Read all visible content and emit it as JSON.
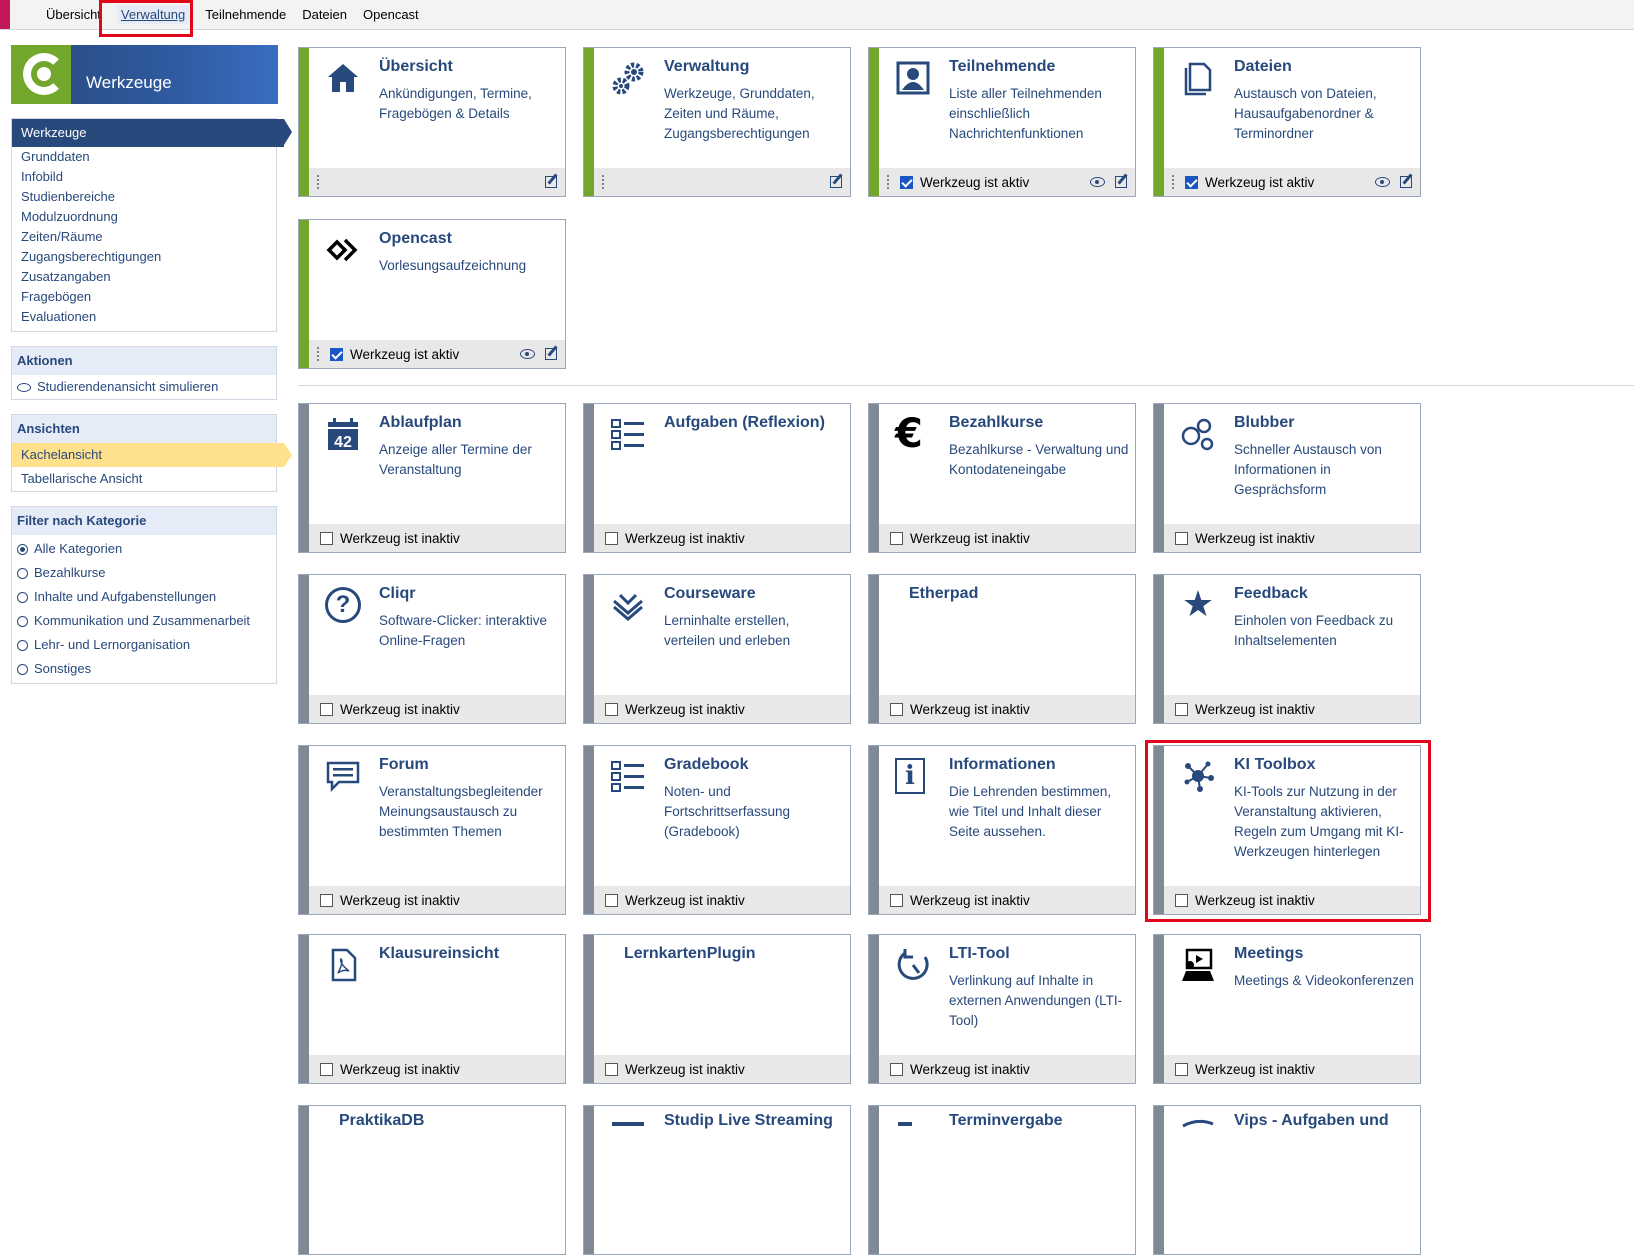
{
  "topnav": {
    "tabs": [
      "Übersicht",
      "Verwaltung",
      "Teilnehmende",
      "Dateien",
      "Opencast"
    ]
  },
  "sidebar": {
    "logo_title": "Werkzeuge",
    "nav": {
      "active": "Werkzeuge",
      "items": [
        "Grunddaten",
        "Infobild",
        "Studienbereiche",
        "Modulzuordnung",
        "Zeiten/Räume",
        "Zugangsberechtigungen",
        "Zusatzangaben",
        "Fragebögen",
        "Evaluationen"
      ]
    },
    "actions": {
      "title": "Aktionen",
      "simulate": "Studierendenansicht simulieren"
    },
    "views": {
      "title": "Ansichten",
      "tiles": "Kachelansicht",
      "table": "Tabellarische Ansicht"
    },
    "filter": {
      "title": "Filter nach Kategorie",
      "options": [
        "Alle Kategorien",
        "Bezahlkurse",
        "Inhalte und Aufgabenstellungen",
        "Kommunikation und Zusammenarbeit",
        "Lehr- und Lernorganisation",
        "Sonstiges"
      ]
    }
  },
  "status": {
    "active": "Werkzeug ist aktiv",
    "inactive": "Werkzeug ist inaktiv"
  },
  "tools": {
    "uebersicht": {
      "name": "Übersicht",
      "desc": "Ankündigungen, Termine, Fragebögen & Details",
      "icon": "home-icon"
    },
    "verwaltung": {
      "name": "Verwaltung",
      "desc": "Werkzeuge, Grunddaten, Zeiten und Räume, Zugangsberechtigungen",
      "icon": "gears-icon"
    },
    "teilnehmende": {
      "name": "Teilnehmende",
      "desc": "Liste aller Teilnehmenden einschließlich Nachrichtenfunktionen",
      "icon": "person-icon"
    },
    "dateien": {
      "name": "Dateien",
      "desc": "Austausch von Dateien, Hausaufgabenordner & Terminordner",
      "icon": "files-icon"
    },
    "opencast": {
      "name": "Opencast",
      "desc": "Vorlesungsaufzeichnung",
      "icon": "opencast-icon"
    },
    "ablaufplan": {
      "name": "Ablaufplan",
      "desc": "Anzeige aller Termine der Veranstaltung",
      "icon": "calendar-icon",
      "badge": "42"
    },
    "aufgaben": {
      "name": "Aufgaben (Reflexion)",
      "desc": "",
      "icon": "checklist-icon"
    },
    "bezahlkurse": {
      "name": "Bezahlkurse",
      "desc": "Bezahlkurse - Verwaltung und Kontodateneingabe",
      "icon": "euro-icon",
      "glyph": "€"
    },
    "blubber": {
      "name": "Blubber",
      "desc": "Schneller Austausch von Informationen in Gesprächsform",
      "icon": "bubbles-icon"
    },
    "cliqr": {
      "name": "Cliqr",
      "desc": "Software-Clicker: interaktive Online-Fragen",
      "icon": "question-icon",
      "glyph": "?"
    },
    "courseware": {
      "name": "Courseware",
      "desc": "Lerninhalte erstellen, verteilen und erleben",
      "icon": "courseware-icon"
    },
    "etherpad": {
      "name": "Etherpad",
      "desc": "",
      "icon": ""
    },
    "feedback": {
      "name": "Feedback",
      "desc": "Einholen von Feedback zu Inhaltselementen",
      "icon": "star-icon",
      "glyph": "★"
    },
    "forum": {
      "name": "Forum",
      "desc": "Veranstaltungsbegleitender Meinungsaustausch zu bestimmten Themen",
      "icon": "forum-icon"
    },
    "gradebook": {
      "name": "Gradebook",
      "desc": "Noten- und Fortschrittserfassung (Gradebook)",
      "icon": "checklist-icon"
    },
    "informationen": {
      "name": "Informationen",
      "desc": "Die Lehrenden bestimmen, wie Titel und Inhalt dieser Seite aussehen.",
      "icon": "info-icon",
      "glyph": "i"
    },
    "ki_toolbox": {
      "name": "KI Toolbox",
      "desc": "KI-Tools zur Nutzung in der Veranstaltung aktivieren, Regeln zum Umgang mit KI-Werkzeugen hinterlegen",
      "icon": "network-icon"
    },
    "klausureinsicht": {
      "name": "Klausureinsicht",
      "desc": "",
      "icon": "pdf-icon"
    },
    "lernkarten": {
      "name": "LernkartenPlugin",
      "desc": "",
      "icon": ""
    },
    "lti": {
      "name": "LTI-Tool",
      "desc": "Verlinkung auf Inhalte in externen Anwendungen (LTI-Tool)",
      "icon": "lti-icon"
    },
    "meetings": {
      "name": "Meetings",
      "desc": "Meetings & Videokonferenzen",
      "icon": "meetings-icon"
    },
    "praktikadb": {
      "name": "PraktikaDB",
      "desc": "",
      "icon": ""
    },
    "studip_live": {
      "name": "Studip Live Streaming",
      "desc": "",
      "icon": ""
    },
    "terminvergabe": {
      "name": "Terminvergabe",
      "desc": "",
      "icon": ""
    },
    "vips": {
      "name": "Vips - Aufgaben und",
      "desc": "",
      "icon": ""
    }
  },
  "colors": {
    "brand": "#28497c",
    "active_strip": "#72a72c",
    "inactive_strip": "#7f8a96",
    "highlight": "#e3061b",
    "selected_view": "#ffe08c"
  }
}
